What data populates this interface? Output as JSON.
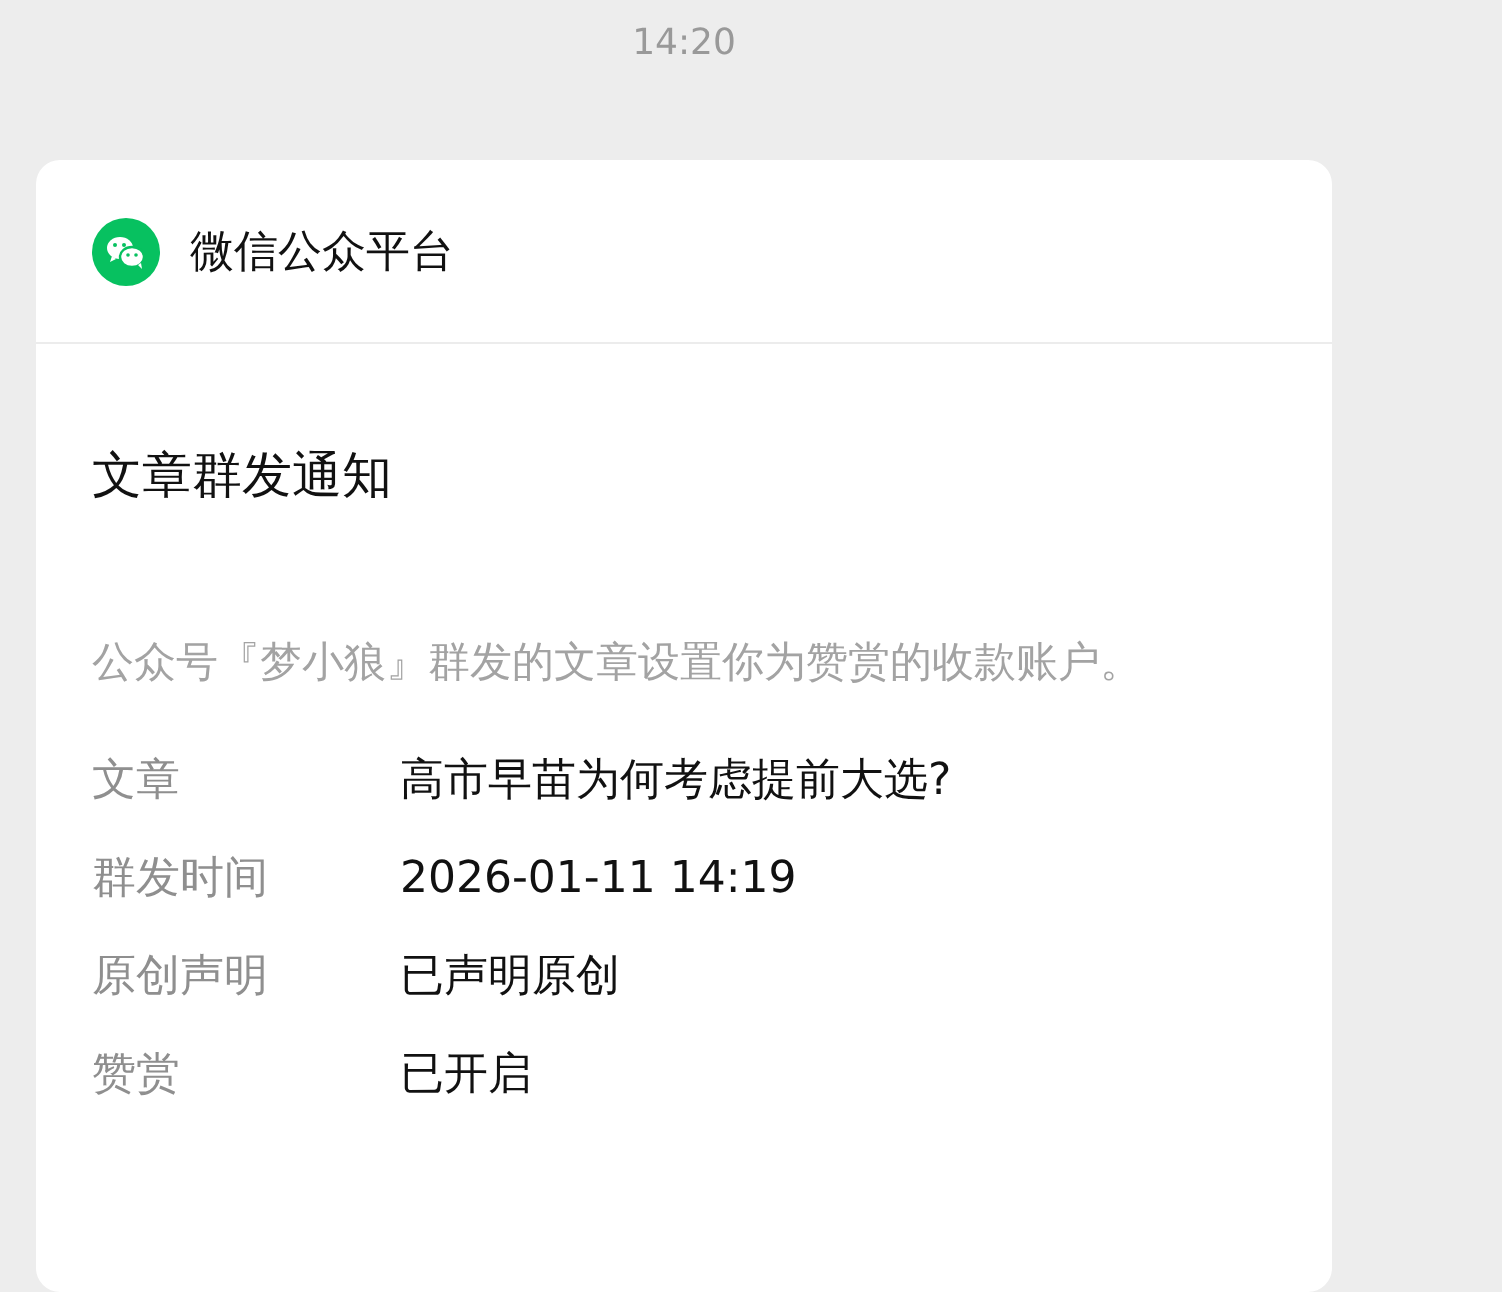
{
  "time": "14:20",
  "card": {
    "source": "微信公众平台",
    "title": "文章群发通知",
    "description": "公众号『梦小狼』群发的文章设置你为赞赏的收款账户。",
    "fields": [
      {
        "label": "文章",
        "value": "高市早苗为何考虑提前大选?"
      },
      {
        "label": "群发时间",
        "value": "2026-01-11 14:19"
      },
      {
        "label": "原创声明",
        "value": "已声明原创"
      },
      {
        "label": "赞赏",
        "value": "已开启"
      }
    ]
  }
}
